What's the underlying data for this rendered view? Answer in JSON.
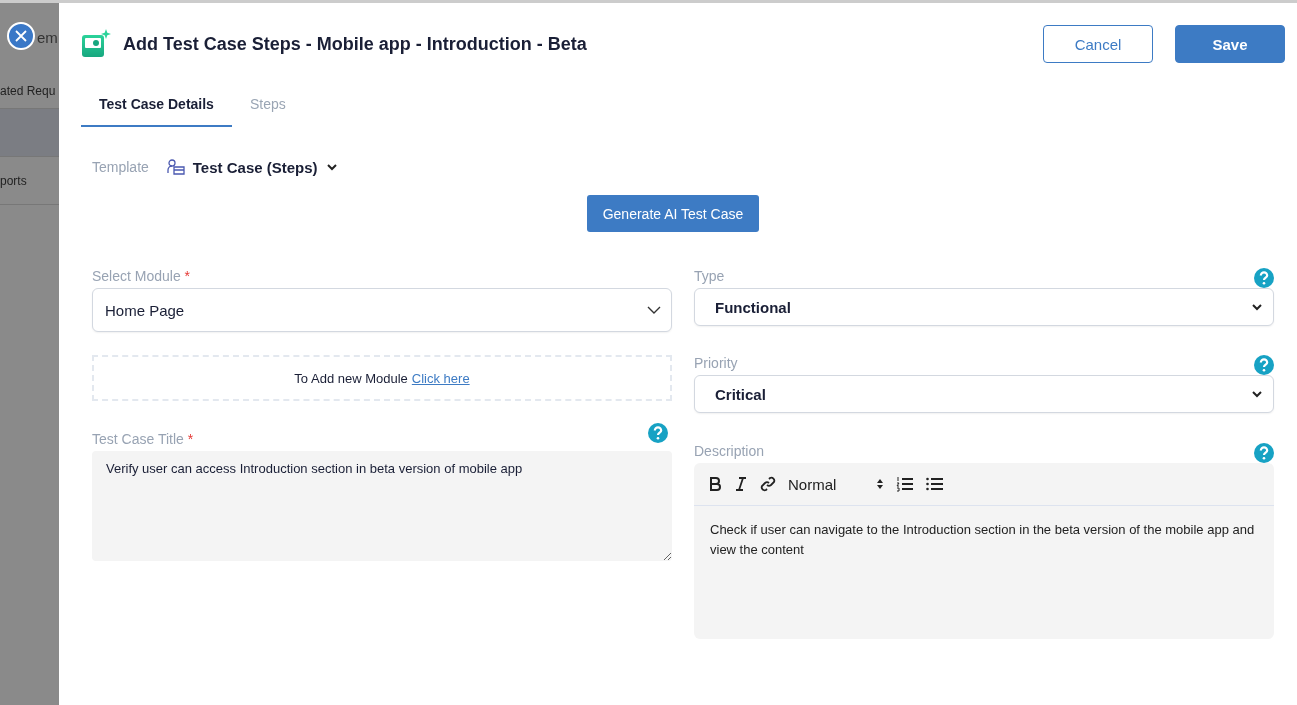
{
  "background": {
    "heading": "em",
    "items": [
      {
        "label": "ated Requ",
        "selected": false
      },
      {
        "selected": true
      },
      {
        "label": "ports",
        "selected": false
      }
    ]
  },
  "dialog": {
    "title": "Add Test Case Steps - Mobile app - Introduction - Beta",
    "buttons": [
      {
        "label": "Cancel",
        "kind": "outline"
      },
      {
        "label": "Save",
        "kind": "primary"
      }
    ]
  },
  "tabs": [
    {
      "label": "Test Case Details",
      "selected": true
    },
    {
      "label": "Steps",
      "selected": false
    }
  ],
  "template": {
    "label": "Template",
    "value": "Test Case (Steps)"
  },
  "generate_button": "Generate AI Test Case",
  "module": {
    "label": "Select Module",
    "required_mark": "*",
    "value": "Home Page",
    "add_text": "To Add new Module",
    "add_link": "Click here"
  },
  "title_field": {
    "label": "Test Case Title",
    "required_mark": "*",
    "value": "Verify user can access Introduction section in beta version of mobile app"
  },
  "type": {
    "label": "Type",
    "value": "Functional"
  },
  "priority": {
    "label": "Priority",
    "value": "Critical"
  },
  "description": {
    "label": "Description",
    "format": "Normal",
    "value": "Check if user can navigate to the Introduction section in the beta version of the mobile app and view the content"
  }
}
